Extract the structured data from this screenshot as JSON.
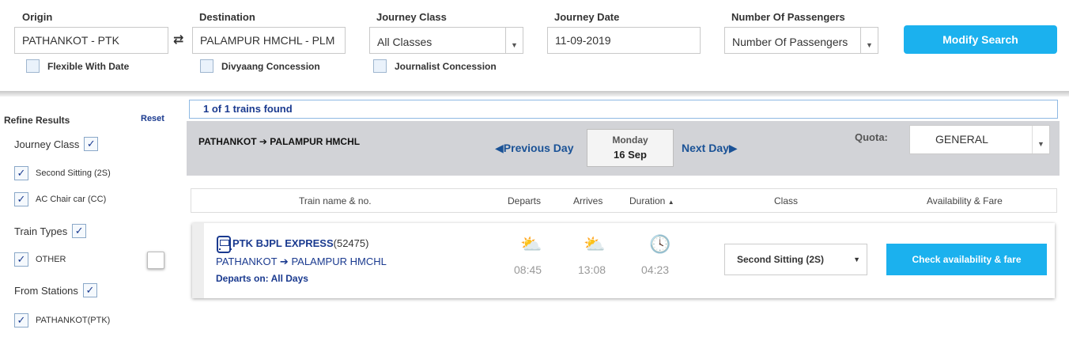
{
  "search": {
    "origin_label": "Origin",
    "origin_value": "PATHANKOT - PTK",
    "destination_label": "Destination",
    "destination_value": "PALAMPUR HMCHL - PLM",
    "class_label": "Journey Class",
    "class_value": "All Classes",
    "date_label": "Journey Date",
    "date_value": "11-09-2019",
    "passengers_label": "Number Of Passengers",
    "passengers_value": "Number Of Passengers",
    "flexible_label": "Flexible With Date",
    "divyaang_label": "Divyaang Concession",
    "journalist_label": "Journalist Concession",
    "modify_button": "Modify Search"
  },
  "refine": {
    "title": "Refine Results",
    "reset": "Reset",
    "journey_class_title": "Journey Class",
    "class_options": [
      "Second Sitting (2S)",
      "AC Chair car (CC)"
    ],
    "train_types_title": "Train Types",
    "type_options": [
      "OTHER"
    ],
    "from_stations_title": "From Stations",
    "station_options": [
      "PATHANKOT(PTK)"
    ]
  },
  "results": {
    "found_text": "1 of 1 trains found",
    "route_from": "PATHANKOT",
    "route_to": "PALAMPUR HMCHL",
    "prev_day": "Previous Day",
    "next_day": "Next Day",
    "day_name": "Monday",
    "day_date": "16 Sep",
    "quota_label": "Quota:",
    "quota_value": "GENERAL"
  },
  "table": {
    "col_train": "Train name & no.",
    "col_departs": "Departs",
    "col_arrives": "Arrives",
    "col_duration": "Duration",
    "col_class": "Class",
    "col_availability": "Availability & Fare"
  },
  "train": {
    "name": "PTK BJPL EXPRESS",
    "number": "(52475)",
    "route_from": "PATHANKOT",
    "route_to": "PALAMPUR HMCHL",
    "departs_on": "Departs on: All Days",
    "departs": "08:45",
    "arrives": "13:08",
    "duration": "04:23",
    "class_value": "Second Sitting (2S)",
    "check_button": "Check availability & fare"
  },
  "colors": {
    "accent": "#1bb1ee",
    "link": "#1a3a8f"
  }
}
